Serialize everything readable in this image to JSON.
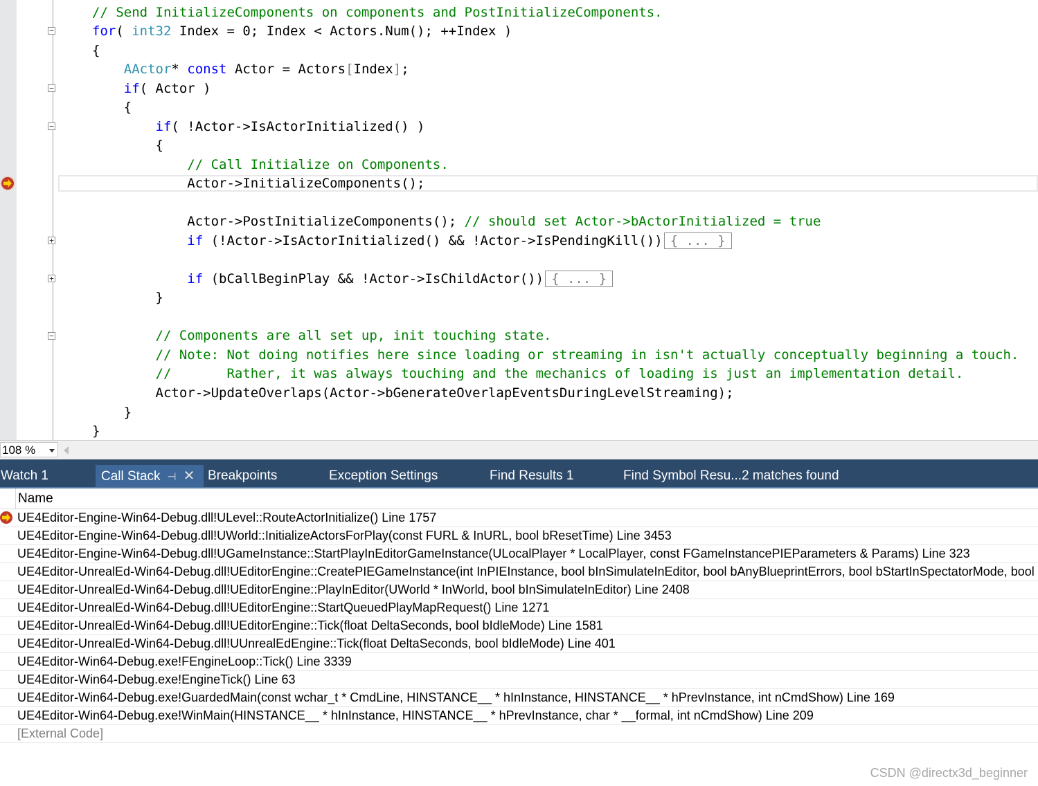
{
  "editor": {
    "lines": [
      [
        {
          "t": "// Send InitializeComponents on components and PostInitializeComponents.",
          "c": "cm"
        }
      ],
      [
        {
          "t": "for",
          "c": "kw"
        },
        {
          "t": "( "
        },
        {
          "t": "int32",
          "c": "ty"
        },
        {
          "t": " Index = 0; Index < Actors.Num(); ++Index )"
        }
      ],
      [
        {
          "t": "{"
        }
      ],
      [
        {
          "t": "    "
        },
        {
          "t": "AActor",
          "c": "ty"
        },
        {
          "t": "* "
        },
        {
          "t": "const",
          "c": "kw"
        },
        {
          "t": " Actor = Actors"
        },
        {
          "t": "[",
          "c": "gray"
        },
        {
          "t": "Index"
        },
        {
          "t": "]",
          "c": "gray"
        },
        {
          "t": ";"
        }
      ],
      [
        {
          "t": "    "
        },
        {
          "t": "if",
          "c": "kw"
        },
        {
          "t": "( Actor )"
        }
      ],
      [
        {
          "t": "    {"
        }
      ],
      [
        {
          "t": "        "
        },
        {
          "t": "if",
          "c": "kw"
        },
        {
          "t": "( !Actor->IsActorInitialized() )"
        }
      ],
      [
        {
          "t": "        {"
        }
      ],
      [
        {
          "t": "            "
        },
        {
          "t": "// Call Initialize on Components.",
          "c": "cm"
        }
      ],
      [
        {
          "t": "            Actor->InitializeComponents();"
        }
      ],
      [
        {
          "t": ""
        }
      ],
      [
        {
          "t": "            Actor->PostInitializeComponents(); "
        },
        {
          "t": "// should set Actor->bActorInitialized = true",
          "c": "cm"
        }
      ],
      [
        {
          "t": "            "
        },
        {
          "t": "if",
          "c": "kw"
        },
        {
          "t": " (!Actor->IsActorInitialized() && !Actor->IsPendingKill())"
        },
        {
          "t": "{ ... }",
          "c": "collapsed"
        }
      ],
      [
        {
          "t": ""
        }
      ],
      [
        {
          "t": "            "
        },
        {
          "t": "if",
          "c": "kw"
        },
        {
          "t": " (bCallBeginPlay && !Actor->IsChildActor())"
        },
        {
          "t": "{ ... }",
          "c": "collapsed"
        }
      ],
      [
        {
          "t": "        }"
        }
      ],
      [
        {
          "t": ""
        }
      ],
      [
        {
          "t": "        "
        },
        {
          "t": "// Components are all set up, init touching state.",
          "c": "cm"
        }
      ],
      [
        {
          "t": "        "
        },
        {
          "t": "// Note: Not doing notifies here since loading or streaming in isn't actually conceptually beginning a touch.",
          "c": "cm"
        }
      ],
      [
        {
          "t": "        "
        },
        {
          "t": "//       Rather, it was always touching and the mechanics of loading is just an implementation detail.",
          "c": "cm"
        }
      ],
      [
        {
          "t": "        Actor->UpdateOverlaps(Actor->bGenerateOverlapEventsDuringLevelStreaming);"
        }
      ],
      [
        {
          "t": "    }"
        }
      ],
      [
        {
          "t": "}"
        }
      ]
    ],
    "zoom": "108 %"
  },
  "tabs": {
    "watch": "Watch 1",
    "callstack": "Call Stack",
    "breakpoints": "Breakpoints",
    "exceptions": "Exception Settings",
    "find_results": "Find Results 1",
    "find_symbol": "Find Symbol Resu...2 matches found"
  },
  "callstack": {
    "header": "Name",
    "rows": [
      "UE4Editor-Engine-Win64-Debug.dll!ULevel::RouteActorInitialize() Line 1757",
      "UE4Editor-Engine-Win64-Debug.dll!UWorld::InitializeActorsForPlay(const FURL & InURL, bool bResetTime) Line 3453",
      "UE4Editor-Engine-Win64-Debug.dll!UGameInstance::StartPlayInEditorGameInstance(ULocalPlayer * LocalPlayer, const FGameInstancePIEParameters & Params) Line 323",
      "UE4Editor-UnrealEd-Win64-Debug.dll!UEditorEngine::CreatePIEGameInstance(int InPIEInstance, bool bInSimulateInEditor, bool bAnyBlueprintErrors, bool bStartInSpectatorMode, bool bRu",
      "UE4Editor-UnrealEd-Win64-Debug.dll!UEditorEngine::PlayInEditor(UWorld * InWorld, bool bInSimulateInEditor) Line 2408",
      "UE4Editor-UnrealEd-Win64-Debug.dll!UEditorEngine::StartQueuedPlayMapRequest() Line 1271",
      "UE4Editor-UnrealEd-Win64-Debug.dll!UEditorEngine::Tick(float DeltaSeconds, bool bIdleMode) Line 1581",
      "UE4Editor-UnrealEd-Win64-Debug.dll!UUnrealEdEngine::Tick(float DeltaSeconds, bool bIdleMode) Line 401",
      "UE4Editor-Win64-Debug.exe!FEngineLoop::Tick() Line 3339",
      "UE4Editor-Win64-Debug.exe!EngineTick() Line 63",
      "UE4Editor-Win64-Debug.exe!GuardedMain(const wchar_t * CmdLine, HINSTANCE__ * hInInstance, HINSTANCE__ * hPrevInstance, int nCmdShow) Line 169",
      "UE4Editor-Win64-Debug.exe!WinMain(HINSTANCE__ * hInInstance, HINSTANCE__ * hPrevInstance, char * __formal, int nCmdShow) Line 209",
      "[External Code]"
    ]
  },
  "watermark": "CSDN @directx3d_beginner"
}
